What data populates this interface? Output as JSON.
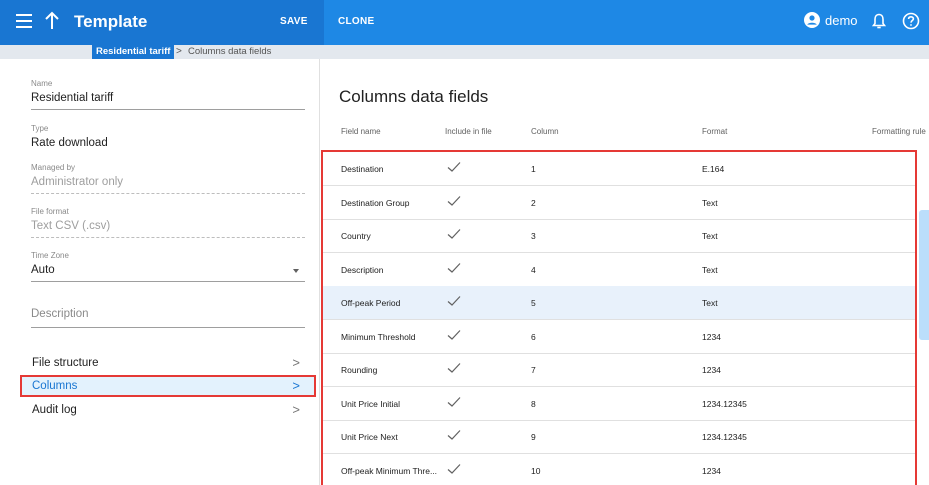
{
  "header": {
    "title": "Template",
    "save_label": "SAVE",
    "clone_label": "CLONE",
    "user": "demo",
    "icons": [
      "menu-icon",
      "arrow-up-icon",
      "account-icon",
      "bell-icon",
      "help-icon"
    ],
    "brand_color": "#1e88e5"
  },
  "breadcrumb": {
    "parent": "Residential tariff",
    "separator": ">",
    "current": "Columns data fields"
  },
  "form": {
    "name_label": "Name",
    "name_value": "Residential tariff",
    "type_label": "Type",
    "type_value": "Rate download",
    "managed_label": "Managed by",
    "managed_value": "Administrator only",
    "format_label": "File format",
    "format_value": "Text CSV (.csv)",
    "tz_label": "Time Zone",
    "tz_value": "Auto",
    "description_placeholder": "Description"
  },
  "nav": {
    "items": [
      {
        "label": "File structure",
        "active": false
      },
      {
        "label": "Columns",
        "active": true
      },
      {
        "label": "Audit log",
        "active": false
      }
    ],
    "chevron": ">"
  },
  "main": {
    "title": "Columns data fields",
    "columns": [
      "Field name",
      "Include in file",
      "Column",
      "Format",
      "Formatting rule"
    ],
    "rows": [
      {
        "field": "Destination",
        "column": "1",
        "format": "E.164"
      },
      {
        "field": "Destination Group",
        "column": "2",
        "format": "Text"
      },
      {
        "field": "Country",
        "column": "3",
        "format": "Text"
      },
      {
        "field": "Description",
        "column": "4",
        "format": "Text"
      },
      {
        "field": "Off-peak Period",
        "column": "5",
        "format": "Text"
      },
      {
        "field": "Minimum Threshold",
        "column": "6",
        "format": "1234"
      },
      {
        "field": "Rounding",
        "column": "7",
        "format": "1234"
      },
      {
        "field": "Unit Price Initial",
        "column": "8",
        "format": "1234.12345"
      },
      {
        "field": "Unit Price Next",
        "column": "9",
        "format": "1234.12345"
      },
      {
        "field": "Off-peak Minimum Thre...",
        "column": "10",
        "format": "1234"
      }
    ],
    "highlighted_row": 4
  }
}
